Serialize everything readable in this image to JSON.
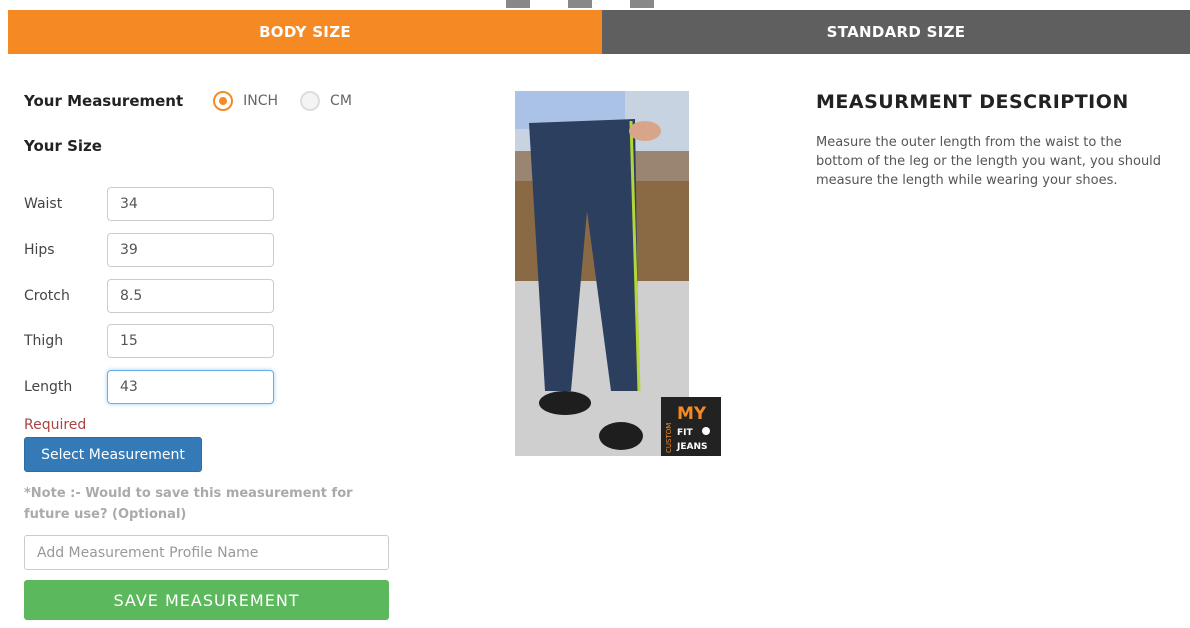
{
  "tabs": {
    "body_size": "BODY SIZE",
    "standard_size": "STANDARD SIZE"
  },
  "measurement": {
    "title": "Your Measurement",
    "units": [
      "INCH",
      "CM"
    ],
    "selected_unit": "INCH"
  },
  "size": {
    "title": "Your Size",
    "fields": [
      {
        "label": "Waist",
        "value": "34"
      },
      {
        "label": "Hips",
        "value": "39"
      },
      {
        "label": "Crotch",
        "value": "8.5"
      },
      {
        "label": "Thigh",
        "value": "15"
      },
      {
        "label": "Length",
        "value": "43"
      }
    ]
  },
  "required_text": "Required",
  "select_button": "Select Measurement",
  "note": "*Note :- Would to save this measurement for future use? (Optional)",
  "profile": {
    "placeholder": "Add Measurement Profile Name",
    "value": ""
  },
  "save_button": "SAVE MEASUREMENT",
  "image": {
    "logo_text": [
      "CUSTOM",
      "MY",
      "FIT",
      "JEANS"
    ]
  },
  "description": {
    "title": "MEASURMENT DESCRIPTION",
    "text": "Measure the outer length from the waist to the bottom of the leg or the length you want, you should measure the length while wearing your shoes."
  },
  "colors": {
    "accent": "#f58a24",
    "tab_inactive": "#5f5f5f",
    "primary": "#337ab7",
    "success": "#5cb85c",
    "error": "#a94442",
    "tape": "#b5d63a"
  }
}
